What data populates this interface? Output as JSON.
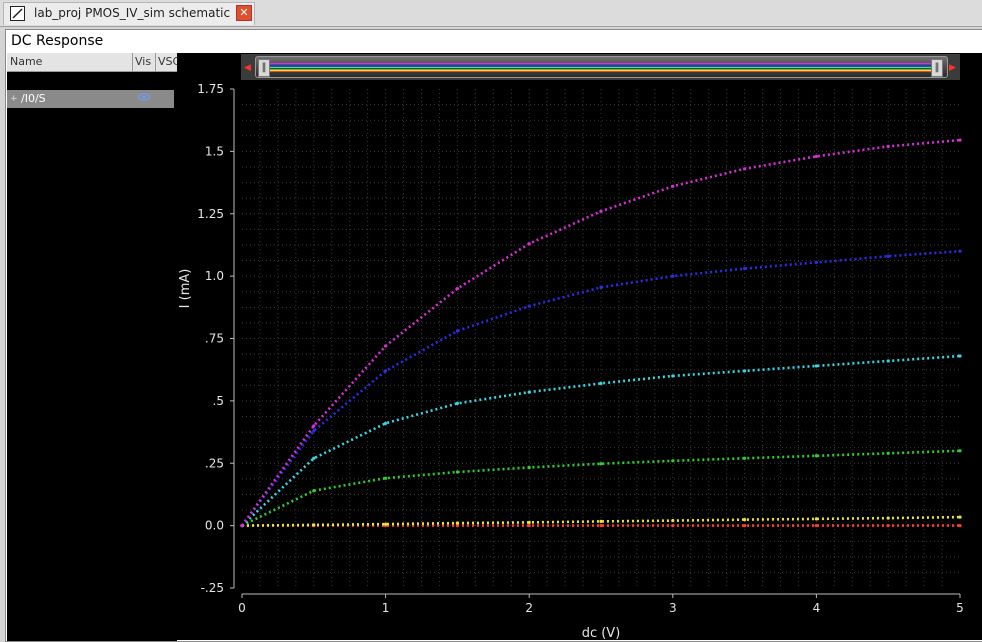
{
  "tab": {
    "title": "lab_proj PMOS_IV_sim schematic",
    "icon": "schematic-icon",
    "close": "✕"
  },
  "window": {
    "title": "DC Response"
  },
  "signal_list": {
    "columns": [
      "Name",
      "Vis",
      "VSC"
    ],
    "rows": [
      {
        "expand": "+",
        "name": "/I0/S",
        "vis": "eye-icon"
      }
    ]
  },
  "chart_data": {
    "type": "line",
    "xlabel": "dc (V)",
    "ylabel": "I (mA)",
    "xlim": [
      0,
      5
    ],
    "ylim": [
      -0.25,
      1.75
    ],
    "x_ticks": [
      "0",
      "1",
      "2",
      "3",
      "4",
      "5"
    ],
    "y_ticks": [
      "-.25",
      "0.0",
      ".25",
      ".5",
      ".75",
      "1.0",
      "1.25",
      "1.5",
      "1.75"
    ],
    "grid": true,
    "x": [
      0,
      0.5,
      1,
      1.5,
      2,
      2.5,
      3,
      3.5,
      4,
      4.5,
      5
    ],
    "series": [
      {
        "color": "#ff3a2f",
        "values": [
          0,
          0,
          0,
          0,
          0,
          0,
          0,
          0,
          0,
          0,
          0
        ]
      },
      {
        "color": "#e8e82a",
        "values": [
          0,
          0.003,
          0.006,
          0.01,
          0.013,
          0.017,
          0.02,
          0.024,
          0.027,
          0.03,
          0.034
        ]
      },
      {
        "color": "#2fcf2f",
        "values": [
          0,
          0.14,
          0.19,
          0.215,
          0.233,
          0.248,
          0.26,
          0.27,
          0.28,
          0.29,
          0.3
        ]
      },
      {
        "color": "#38d7e6",
        "values": [
          0,
          0.27,
          0.41,
          0.49,
          0.535,
          0.57,
          0.6,
          0.62,
          0.64,
          0.66,
          0.68
        ]
      },
      {
        "color": "#2a2ee6",
        "values": [
          0,
          0.38,
          0.62,
          0.78,
          0.88,
          0.955,
          1.0,
          1.03,
          1.055,
          1.08,
          1.1
        ]
      },
      {
        "color": "#d92ed9",
        "values": [
          0,
          0.4,
          0.72,
          0.95,
          1.13,
          1.26,
          1.36,
          1.43,
          1.48,
          1.52,
          1.545
        ]
      }
    ]
  },
  "colors": {
    "plot_bg": "#000000",
    "grid": "#3a3a3a",
    "axis": "#bbbbbb",
    "text": "#e6e6e6"
  }
}
